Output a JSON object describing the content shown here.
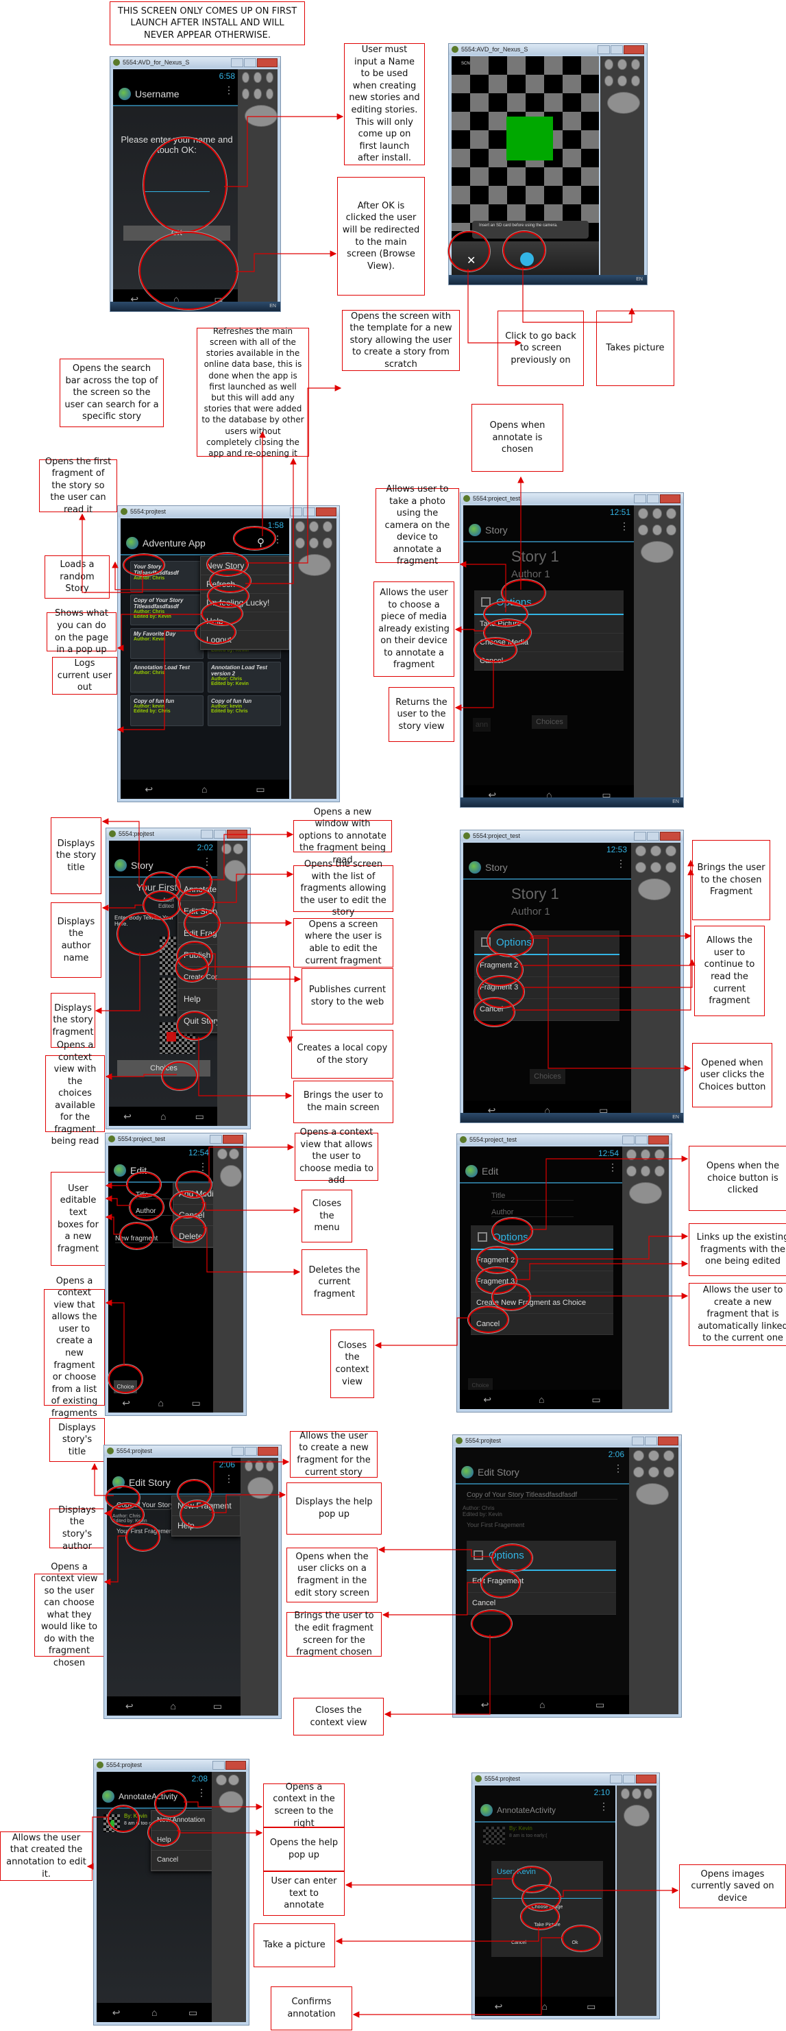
{
  "colors": {
    "annotation_border": "#e00000",
    "accent_blue": "#33b5e5",
    "author_green": "#9acd00",
    "emulator_bg": "#111418"
  },
  "notes": {
    "first_launch": "THIS SCREEN ONLY COMES UP ON FIRST LAUNCH AFTER INSTALL AND WILL NEVER APPEAR OTHERWISE.",
    "username_input": "User must input a Name to be used when creating new stories and editing stories. This will only come up on first launch after install.",
    "ok_redirect": "After OK is clicked the user will be redirected to the main screen (Browse View).",
    "camera_back": "Click to go back to screen previously on",
    "camera_take": "Takes picture",
    "new_story": "Opens the screen with the template for a new story allowing the user to create a story from scratch",
    "refresh": "Refreshes the main screen with all of the stories available in the online data base, this is done when the app is first launched as well but this will add any stories that were added to the database by other users without completely closing the app and re-opening it",
    "search": "Opens the search bar across the top of the screen so the user can search for a specific story",
    "open_first": "Opens the first fragment of the story so the user can read it",
    "random": "Loads a random Story",
    "help_popup": "Shows what you can do on the page in a pop up",
    "logout": "Logs current user out",
    "annotate_opens": "Opens when annotate is chosen",
    "take_photo": "Allows user to take a photo using the camera on the device to annotate a fragment",
    "choose_media": "Allows the user to choose a piece of media already existing on their device to annotate a fragment",
    "return_story": "Returns the user to the story view",
    "story_title": "Displays the story title",
    "author_name": "Displays the author name",
    "story_fragment": "Displays the story fragment",
    "choices_context": "Opens a context view with the choices available for the fragment being read",
    "annotate_window": "Opens a new window with options to annotate the fragment being read",
    "edit_story": "Opens the screen with the list of fragments allowing the user to edit the story",
    "edit_fragment": "Opens a screen where the user is able to edit the current fragment",
    "publish": "Publishes current story to the web",
    "copy": "Creates a local copy of the story",
    "quit": "Brings the user to the main screen",
    "chosen_fragment": "Brings the user to the chosen Fragment",
    "continue_read": "Allows the user to continue to read the current fragment",
    "choices_opened": "Opened when user clicks the Choices button",
    "editable_boxes": "User editable text boxes for a new fragment",
    "choice_context": "Opens a context view that allows the user to create a new fragment or choose from a list of existing fragments",
    "add_media": "Opens a context view that allows the user to choose media to add",
    "close_menu": "Closes the menu",
    "delete": "Deletes the current fragment",
    "choice_opens": "Opens when the choice button is clicked",
    "link_existing": "Links up the existing fragments with the one being edited",
    "new_linked": "Allows the user to create a new fragment that is automatically linked to the current one",
    "close_context": "Closes the context view",
    "es_title": "Displays story's title",
    "es_author": "Displays the story's author",
    "es_context": "Opens a context view so the user can choose what they would like to do with the fragment chosen",
    "es_new_fragment": "Allows the user to create a new fragment for the current story",
    "es_help": "Displays the help pop up",
    "es_opens": "Opens when the user clicks on a fragment in the edit story screen",
    "es_edit_frag": "Brings the user to the edit fragment screen for the fragment chosen",
    "es_close": "Closes the context view",
    "an_edit": "Allows the user that created the annotation to edit it.",
    "an_context": "Opens a context in the screen to the right",
    "an_help": "Opens the help pop up",
    "an_text": "User can enter text to annotate",
    "an_picture": "Take a picture",
    "an_confirm": "Confirms annotation",
    "an_images": "Opens images currently saved on device"
  },
  "screens": {
    "username": {
      "window": "5554:AVD_for_Nexus_S",
      "time": "6:58",
      "title": "Username",
      "prompt": "Please enter your name and touch OK:",
      "input_value": "",
      "ok": "OK",
      "taskbar": "EN"
    },
    "camera": {
      "window": "5554:AVD_for_Nexus_S",
      "scn": "SCN",
      "toast": "Insert an SD card before using the camera.",
      "close": "✕",
      "taskbar": "EN"
    },
    "browse": {
      "window": "5554:projtest",
      "time": "1:58",
      "title": "Adventure App",
      "menu": [
        "New Story",
        "Refresh",
        "I'm feeling Lucky!",
        "Help",
        "Logout"
      ],
      "cards": [
        {
          "title": "Your Story Titleasdfasdfasdf",
          "author": "Author: Chris",
          "edited": ""
        },
        {
          "title": "",
          "author": "",
          "edited": ""
        },
        {
          "title": "Copy of Your Story Titleasdfasdfasdf",
          "author": "Author: Chris",
          "edited": "Edited by: Kevin"
        },
        {
          "title": "",
          "author": "",
          "edited": ""
        },
        {
          "title": "My Favorite Day",
          "author": "Author: Kevin",
          "edited": ""
        },
        {
          "title": "Copy of Your Story Titleasdfasdfasdf",
          "author": "Author: Chris",
          "edited": "Edited by: Kevin"
        },
        {
          "title": "Annotation Load Test",
          "author": "Author: Chris",
          "edited": ""
        },
        {
          "title": "Annotation Load Test version 2",
          "author": "Author: Chris",
          "edited": "Edited by: Kevin"
        },
        {
          "title": "Copy of fun fun",
          "author": "Author: kevin",
          "edited": "Edited by: Chris"
        },
        {
          "title": "Copy of fun fun",
          "author": "Author: kevin",
          "edited": "Edited by: Chris"
        }
      ]
    },
    "story_annotate": {
      "window": "5554:project_test",
      "time": "12:51",
      "title": "Story",
      "story_title": "Story 1",
      "author": "Author 1",
      "dialog_title": "Options",
      "items": [
        "Take Picture",
        "Choose Media",
        "Cancel"
      ],
      "choices": "Choices",
      "ann": "ann",
      "taskbar": "EN"
    },
    "story_menu": {
      "window": "5554:projtest",
      "time": "2:02",
      "title": "Story",
      "story_title": "Your First",
      "author_line1": "Auth",
      "author_line2": "Edited",
      "body": "Enter Body Text for Your Here.",
      "menu": [
        "Annotate",
        "Edit Story",
        "Edit Fragement",
        "Publish",
        "Create Copy of Story",
        "Help",
        "Quit Story"
      ],
      "choices": "Choices"
    },
    "story_choices": {
      "window": "5554:project_test",
      "time": "12:53",
      "title": "Story",
      "story_title": "Story 1",
      "author": "Author 1",
      "dialog_title": "Options",
      "items": [
        "Fragment 2",
        "Fragment 3",
        "Cancel"
      ],
      "choices": "Choices",
      "taskbar": "EN"
    },
    "edit_menu": {
      "window": "5554:project_test",
      "time": "12:54",
      "title": "Edit",
      "fields": [
        "Title",
        "Author",
        "New fragment"
      ],
      "menu": [
        "Add Media",
        "Cancel",
        "Delete"
      ],
      "choice": "Choice"
    },
    "edit_choice": {
      "window": "5554:project_test",
      "time": "12:54",
      "title": "Edit",
      "fields": [
        "Title",
        "Author"
      ],
      "dialog_title": "Options",
      "items": [
        "Fragment 2",
        "Fragment 3",
        "Create New Fragment as Choice",
        "Cancel"
      ],
      "choice": "Choice"
    },
    "editstory_menu": {
      "window": "5554:projtest",
      "time": "2:06",
      "title": "Edit Story",
      "story_title": "Copy of Your Story",
      "author": "Author: Chris",
      "edited": "Edited by: Kevin",
      "fragment": "Your First Fragement",
      "menu": [
        "New Fragment",
        "Help"
      ]
    },
    "editstory_dialog": {
      "window": "5554:projtest",
      "time": "2:06",
      "title": "Edit Story",
      "story_title": "Copy of Your Story Titleasdfasdfasdf",
      "author": "Author: Chris",
      "edited": "Edited by: Kevin",
      "fragment": "Your First Fragement",
      "dialog_title": "Options",
      "items": [
        "Edit Fragement",
        "Cancel"
      ]
    },
    "annotate_menu": {
      "window": "5554:projtest",
      "time": "2:08",
      "title": "AnnotateActivity",
      "by": "By: Kevin",
      "text": "8 am is too ea",
      "menu": [
        "New Annotation",
        "Help",
        "Cancel"
      ]
    },
    "annotate_dialog": {
      "window": "5554:projtest",
      "time": "2:10",
      "title": "AnnotateActivity",
      "by": "By: Kevin",
      "text": "8 am is too early:(",
      "dialog_title": "User: Kevin",
      "input_value": "",
      "choose_image": "Choose Image",
      "take_picture": "Take Picture",
      "cancel": "Cancel",
      "ok": "Ok"
    }
  }
}
